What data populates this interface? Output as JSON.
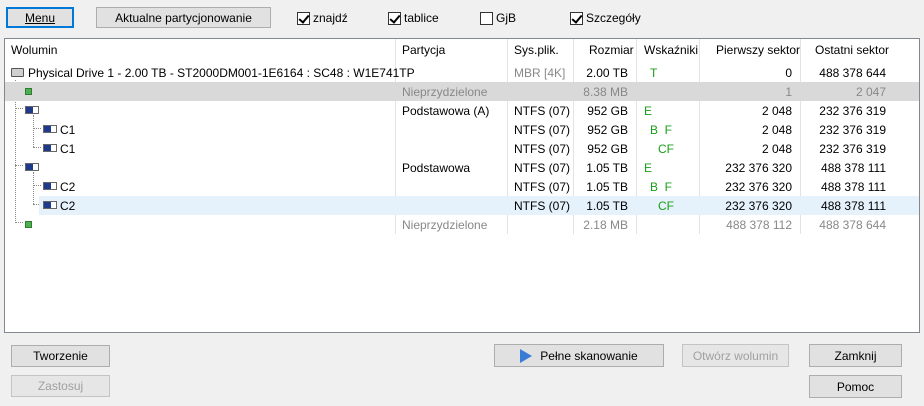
{
  "toolbar": {
    "menu_label": "Menu",
    "current_partitioning_label": "Aktualne partycjonowanie",
    "checkboxes": [
      {
        "label": "znajdź",
        "checked": true
      },
      {
        "label": "tablice",
        "checked": true
      },
      {
        "label": "GjB",
        "checked": false
      },
      {
        "label": "Szczegóły",
        "checked": true
      }
    ]
  },
  "table": {
    "columns": [
      "Wolumin",
      "Partycja",
      "Sys.plik.",
      "Rozmiar",
      "Wskaźniki",
      "Pierwszy sektor",
      "Ostatni sektor"
    ],
    "rows": [
      {
        "volume": "Physical Drive 1 - 2.00 TB - ST2000DM001-1E6164 : SC48 : W1E741TP",
        "partition": "",
        "fs": "MBR [4K]",
        "size": "2.00 TB",
        "flags": "T",
        "first": "0",
        "last": "488 378 644",
        "icon": "drive-icon"
      },
      {
        "volume": "",
        "partition": "Nieprzydzielone",
        "fs": "",
        "size": "8.38 MB",
        "flags": "",
        "first": "1",
        "last": "2 047",
        "icon": "unallocated-icon"
      },
      {
        "volume": "",
        "partition": "Podstawowa (A)",
        "fs": "NTFS (07)",
        "size": "952 GB",
        "flags": "E",
        "first": "2 048",
        "last": "232 376 319",
        "icon": "volume-icon"
      },
      {
        "volume": "C1",
        "partition": "",
        "fs": "NTFS (07)",
        "size": "952 GB",
        "flags": "B  F",
        "first": "2 048",
        "last": "232 376 319",
        "icon": "volume-icon"
      },
      {
        "volume": "C1",
        "partition": "",
        "fs": "NTFS (07)",
        "size": "952 GB",
        "flags": "CF",
        "first": "2 048",
        "last": "232 376 319",
        "icon": "volume-icon"
      },
      {
        "volume": "",
        "partition": "Podstawowa",
        "fs": "NTFS (07)",
        "size": "1.05 TB",
        "flags": "E",
        "first": "232 376 320",
        "last": "488 378 111",
        "icon": "volume-icon"
      },
      {
        "volume": "C2",
        "partition": "",
        "fs": "NTFS (07)",
        "size": "1.05 TB",
        "flags": "B  F",
        "first": "232 376 320",
        "last": "488 378 111",
        "icon": "volume-icon"
      },
      {
        "volume": "C2",
        "partition": "",
        "fs": "NTFS (07)",
        "size": "1.05 TB",
        "flags": "CF",
        "first": "232 376 320",
        "last": "488 378 111",
        "icon": "volume-icon"
      },
      {
        "volume": "",
        "partition": "Nieprzydzielone",
        "fs": "",
        "size": "2.18 MB",
        "flags": "",
        "first": "488 378 112",
        "last": "488 378 644",
        "icon": "unallocated-icon"
      }
    ]
  },
  "buttons": {
    "create": "Tworzenie",
    "apply": "Zastosuj",
    "full_scan": "Pełne skanowanie",
    "open_volume": "Otwórz wolumin",
    "close": "Zamknij",
    "help": "Pomoc"
  },
  "colors": {
    "flag_green": "#1a9e1a",
    "selection": "#e5f1fb",
    "unallocated_row": "#d9d9d9"
  }
}
